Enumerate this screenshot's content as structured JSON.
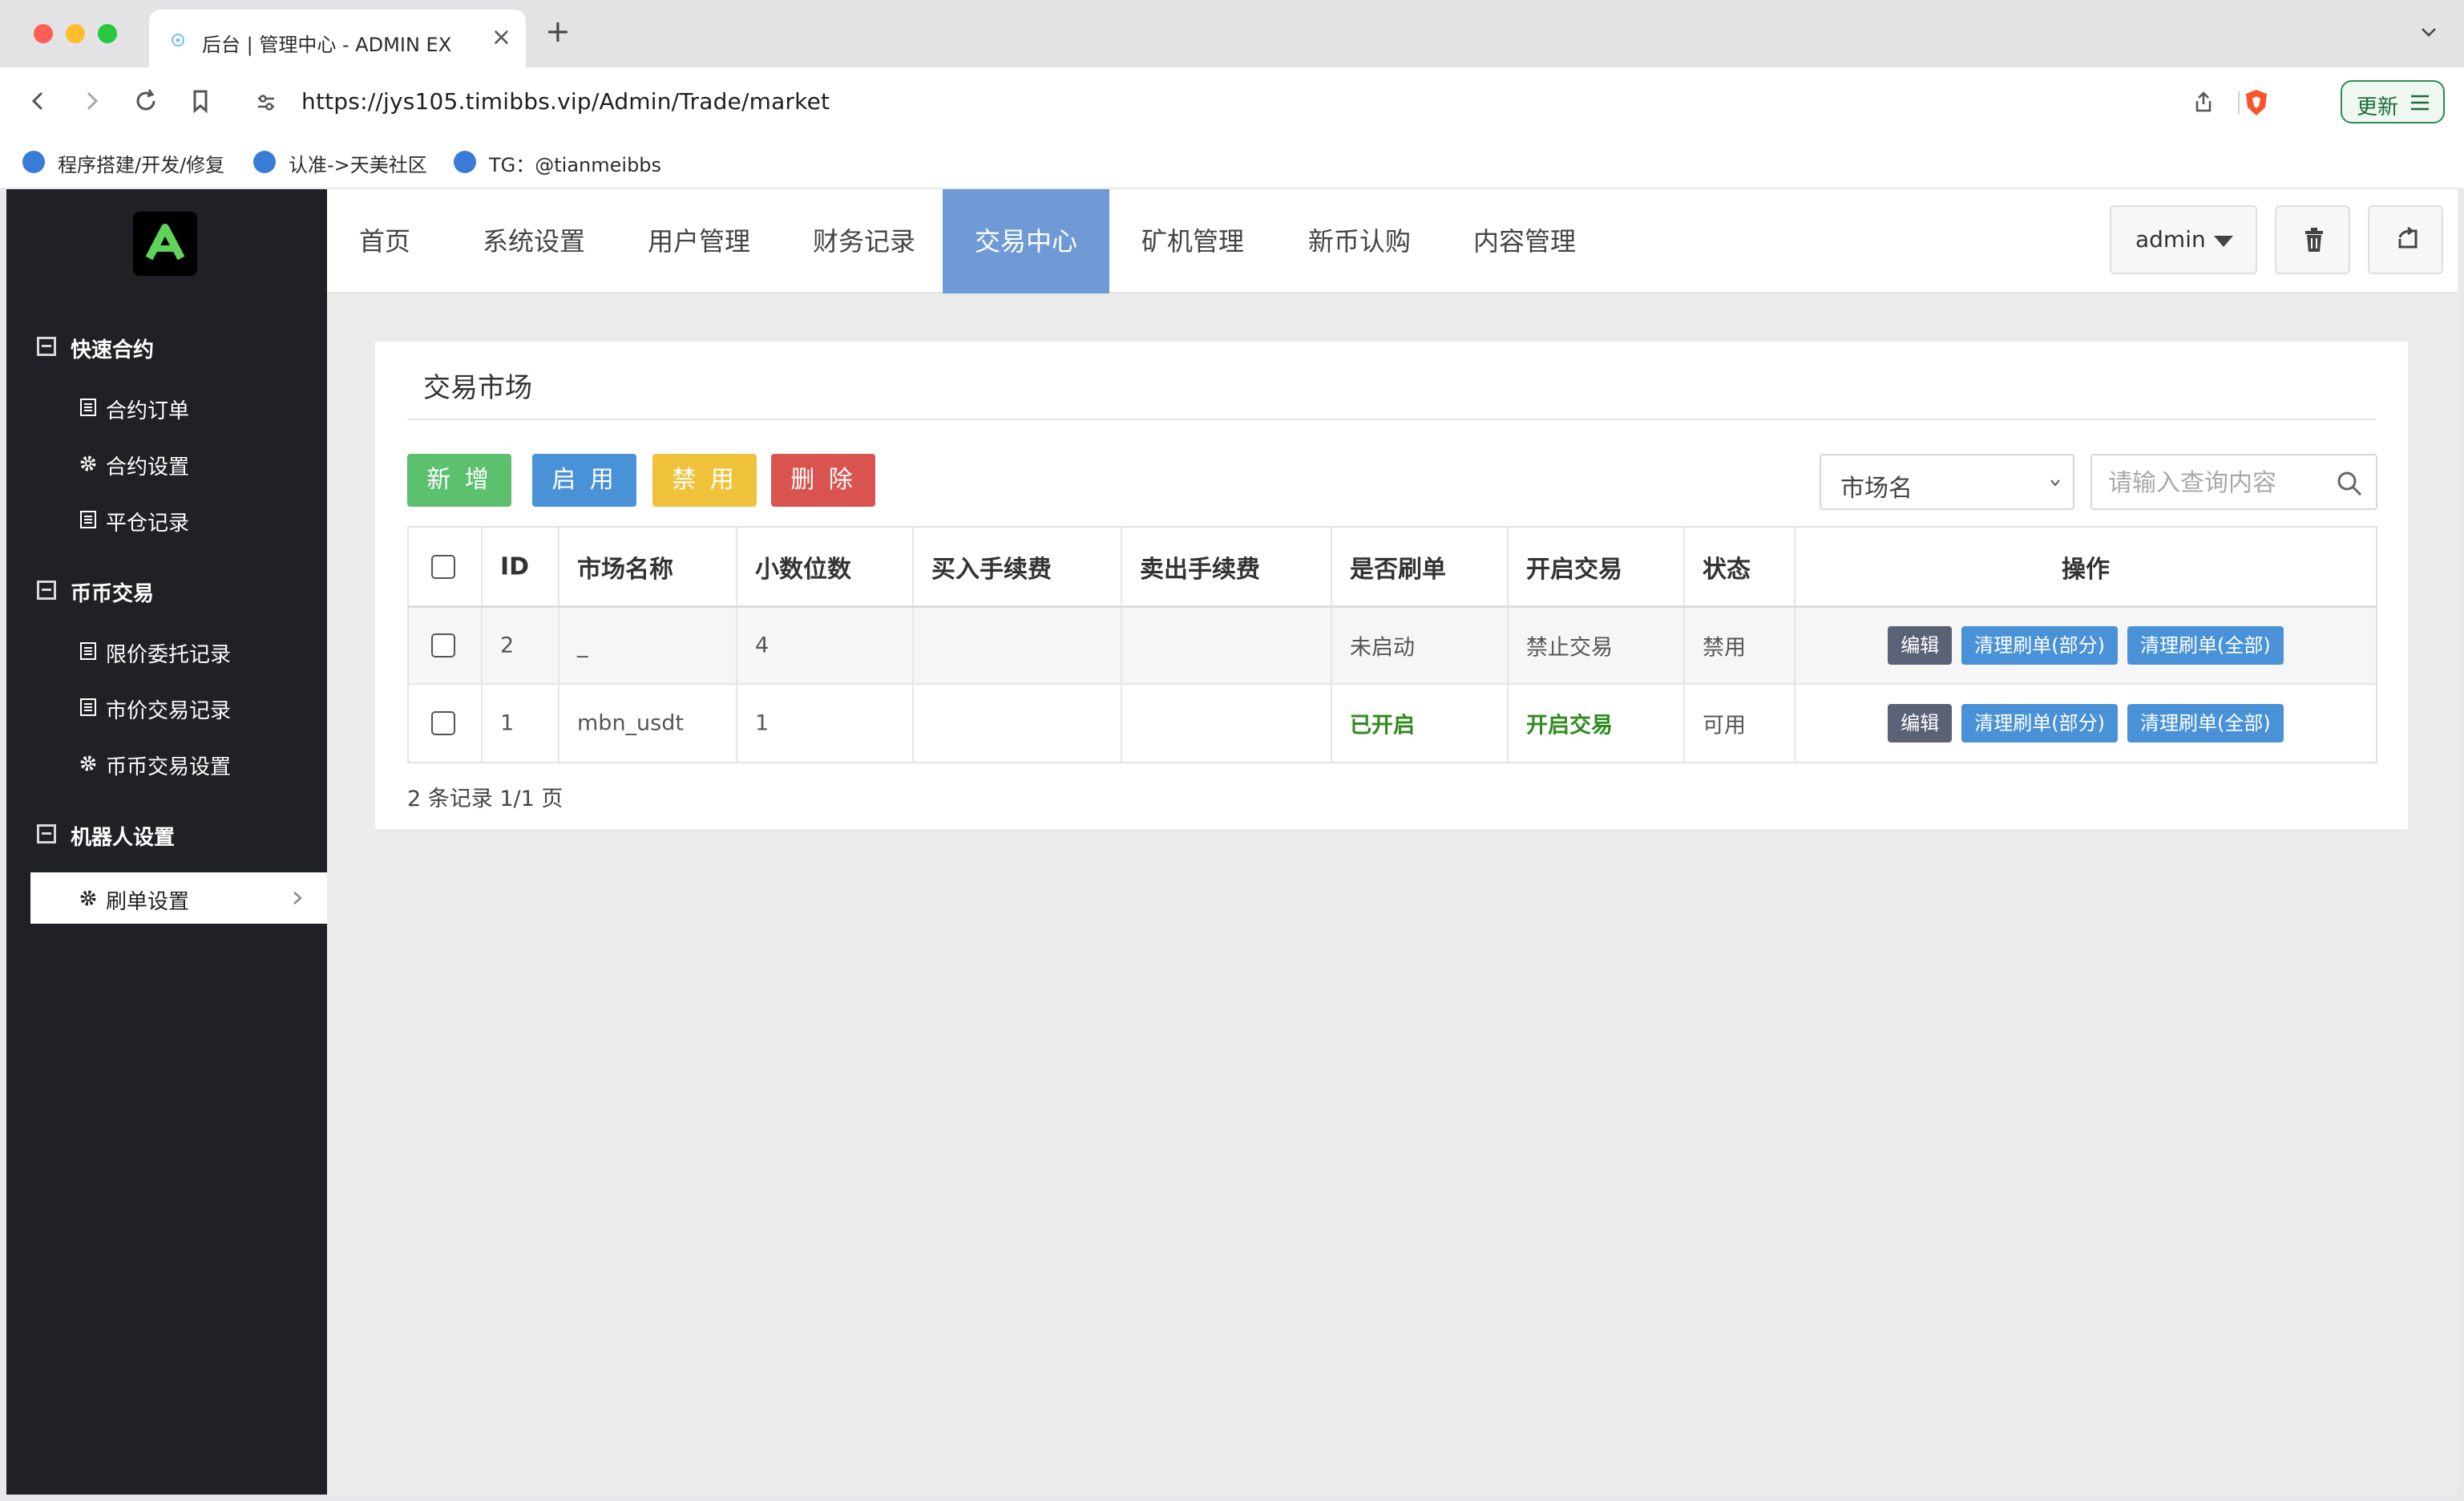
{
  "browser": {
    "tab_title": "后台 | 管理中心 - ADMIN EX",
    "url": "https://jys105.timibbs.vip/Admin/Trade/market",
    "update_label": "更新",
    "bookmarks": [
      {
        "label": "程序搭建/开发/修复",
        "icon": "site-favicon"
      },
      {
        "label": "认准->天美社区",
        "icon": "site-favicon"
      },
      {
        "label": "TG：@tianmeibbs",
        "icon": "site-favicon"
      }
    ]
  },
  "sidebar": {
    "sections": [
      {
        "label": "快速合约",
        "items": [
          {
            "label": "合约订单",
            "icon": "list-icon"
          },
          {
            "label": "合约设置",
            "icon": "gear-icon"
          },
          {
            "label": "平仓记录",
            "icon": "list-icon"
          }
        ]
      },
      {
        "label": "币币交易",
        "items": [
          {
            "label": "限价委托记录",
            "icon": "list-icon"
          },
          {
            "label": "市价交易记录",
            "icon": "list-icon"
          },
          {
            "label": "币币交易设置",
            "icon": "gear-icon"
          }
        ]
      },
      {
        "label": "机器人设置",
        "items": [
          {
            "label": "刷单设置",
            "icon": "gear-icon",
            "active": true
          }
        ]
      }
    ]
  },
  "navbar": {
    "items": [
      "首页",
      "系统设置",
      "用户管理",
      "财务记录",
      "交易中心",
      "矿机管理",
      "新币认购",
      "内容管理"
    ],
    "active": "交易中心",
    "user": "admin"
  },
  "panel": {
    "title": "交易市场",
    "actions": {
      "add": "新 增",
      "enable": "启 用",
      "disable": "禁 用",
      "delete": "删 除"
    },
    "filter_select": "市场名",
    "search_placeholder": "请输入查询内容",
    "table": {
      "headers": [
        "ID",
        "市场名称",
        "小数位数",
        "买入手续费",
        "卖出手续费",
        "是否刷单",
        "开启交易",
        "状态",
        "操作"
      ],
      "rows": [
        {
          "id": "2",
          "name": "_",
          "decimals": "4",
          "buy_fee": "",
          "sell_fee": "",
          "brush": "未启动",
          "trading": "禁止交易",
          "status": "禁用"
        },
        {
          "id": "1",
          "name": "mbn_usdt",
          "decimals": "1",
          "buy_fee": "",
          "sell_fee": "",
          "brush": "已开启",
          "trading": "开启交易",
          "status": "可用"
        }
      ],
      "op_labels": {
        "edit": "编辑",
        "clean_part": "清理刷单(部分)",
        "clean_all": "清理刷单(全部)"
      }
    },
    "pager": "2 条记录 1/1 页"
  },
  "colors": {
    "sidebar_bg": "#202027",
    "nav_active": "#6f9ad6",
    "btn_add": "#5cc06e",
    "btn_enable": "#4a92d8",
    "btn_disable": "#f0c23c",
    "btn_delete": "#d9534f",
    "status_on": "#2f8a1f"
  }
}
